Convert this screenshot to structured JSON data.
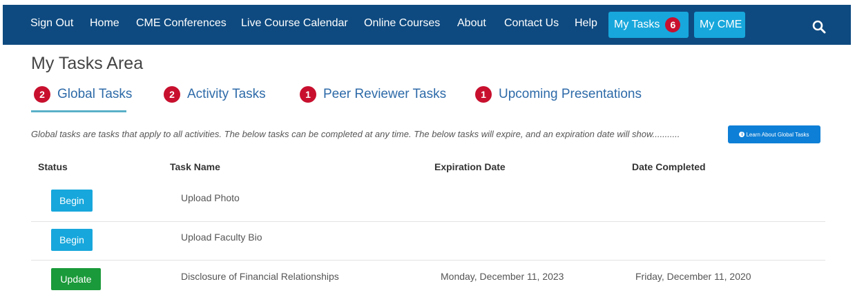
{
  "nav": {
    "items": [
      "Sign Out",
      "Home",
      "CME Conferences",
      "Live Course Calendar",
      "Online Courses",
      "About",
      "Contact Us",
      "Help"
    ],
    "my_tasks_label": "My Tasks",
    "my_tasks_count": "6",
    "my_cme_label": "My CME",
    "search_icon": "search-icon",
    "bg_color": "#0e4a80",
    "button_color": "#17a7dc",
    "badge_color": "#c8102e"
  },
  "page": {
    "title": "My Tasks Area"
  },
  "tabs": [
    {
      "count": "2",
      "label": "Global Tasks",
      "active": true
    },
    {
      "count": "2",
      "label": "Activity Tasks",
      "active": false
    },
    {
      "count": "1",
      "label": "Peer Reviewer Tasks",
      "active": false
    },
    {
      "count": "1",
      "label": "Upcoming Presentations",
      "active": false
    }
  ],
  "description": "Global tasks are tasks that apply to all activities. The below tasks can be completed at any time. The below tasks will expire, and an expiration date will show...........",
  "learn_button": {
    "label": "Learn About Global Tasks",
    "icon": "info-icon"
  },
  "table": {
    "headers": [
      "Status",
      "Task Name",
      "Expiration Date",
      "Date Completed"
    ],
    "rows": [
      {
        "status": "Begin",
        "task": "Upload Photo",
        "expiration": "",
        "completed": ""
      },
      {
        "status": "Begin",
        "task": "Upload Faculty Bio",
        "expiration": "",
        "completed": ""
      },
      {
        "status": "Update",
        "task": "Disclosure of Financial Relationships",
        "expiration": "Monday, December 11, 2023",
        "completed": "Friday, December 11, 2020"
      }
    ]
  }
}
